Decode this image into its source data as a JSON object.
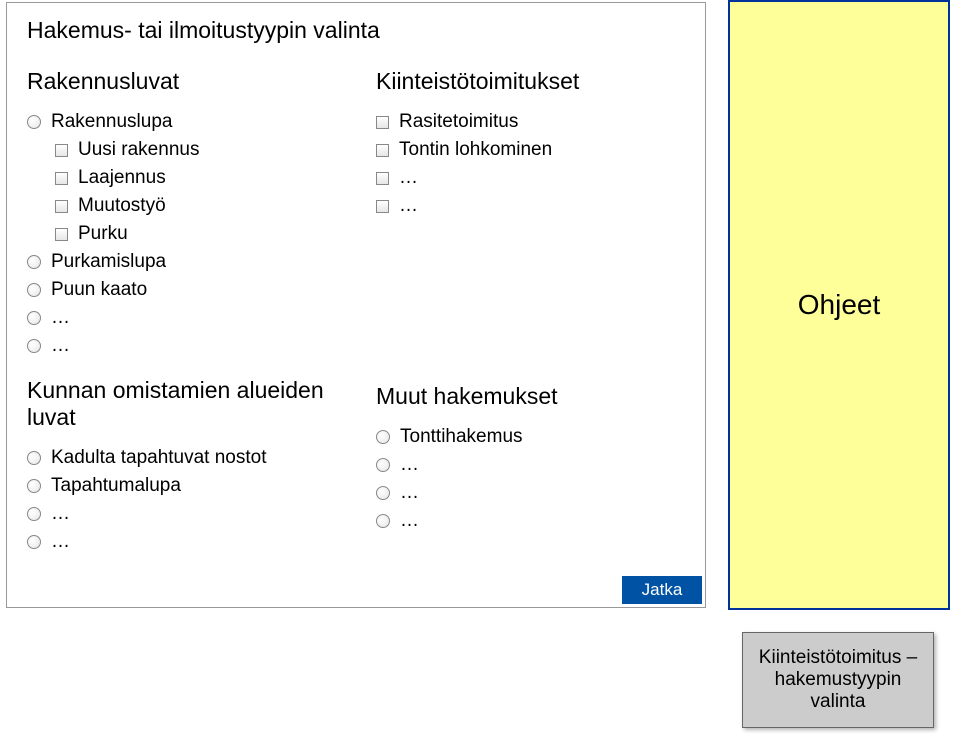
{
  "page_title": "Hakemus- tai ilmoitustyypin valinta",
  "left": {
    "section1_title": "Rakennusluvat",
    "rakennuslupa": "Rakennuslupa",
    "uusi_rakennus": "Uusi rakennus",
    "laajennus": "Laajennus",
    "muutostyo": "Muutostyö",
    "purku": "Purku",
    "purkamislupa": "Purkamislupa",
    "puun_kaato": "Puun kaato",
    "ellipsis1": "…",
    "ellipsis2": "…",
    "section2_title": "Kunnan omistamien alueiden luvat",
    "kadulta": "Kadulta tapahtuvat nostot",
    "tapahtumalupa": "Tapahtumalupa",
    "ellipsis3": "…",
    "ellipsis4": "…"
  },
  "right": {
    "section1_title": "Kiinteistötoimitukset",
    "rasitetoimitus": "Rasitetoimitus",
    "tontin": "Tontin lohkominen",
    "ellipsis1": "…",
    "ellipsis2": "…",
    "section2_title": "Muut hakemukset",
    "tonttihakemus": "Tonttihakemus",
    "ellipsis3": "…",
    "ellipsis4": "…",
    "ellipsis5": "…"
  },
  "ohjeet": "Ohjeet",
  "jatka": "Jatka",
  "footer": "Kiinteistötoimitus – hakemustyypin valinta"
}
